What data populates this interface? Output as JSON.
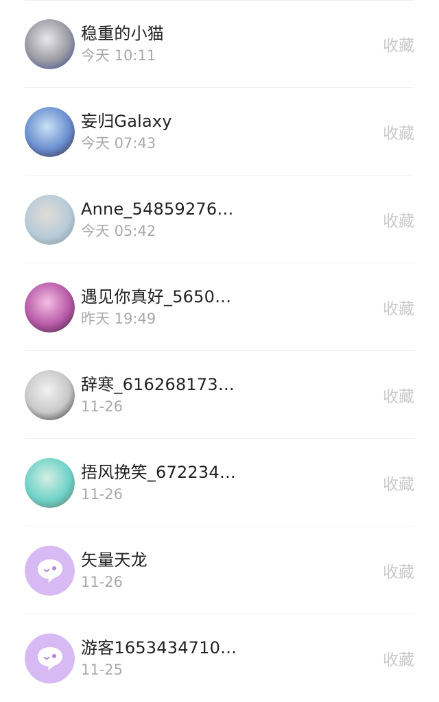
{
  "contacts": [
    {
      "name": "稳重的小猫",
      "time": "今天 10:11",
      "action": "收藏",
      "avatar_type": "photo",
      "avatar_colors": [
        "#e9e7ea",
        "#9a9aa3",
        "#2c3c8c"
      ]
    },
    {
      "name": "妄归Galaxy",
      "time": "今天 07:43",
      "action": "收藏",
      "avatar_type": "photo",
      "avatar_colors": [
        "#c9e1f4",
        "#6b8fd0",
        "#2a1a2a"
      ]
    },
    {
      "name": "Anne_54859276…",
      "time": "今天 05:42",
      "action": "收藏",
      "avatar_type": "photo",
      "avatar_colors": [
        "#e2ddd6",
        "#b7cbd8",
        "#7b8d96"
      ]
    },
    {
      "name": "遇见你真好_5650…",
      "time": "昨天 19:49",
      "action": "收藏",
      "avatar_type": "photo",
      "avatar_colors": [
        "#f4bfe3",
        "#b85aa7",
        "#2b1a2e"
      ]
    },
    {
      "name": "辞寒_616268173…",
      "time": "11-26",
      "action": "收藏",
      "avatar_type": "photo",
      "avatar_colors": [
        "#f2f2f2",
        "#c8c8c8",
        "#1a1a1a"
      ]
    },
    {
      "name": "捂风挽笑_672234…",
      "time": "11-26",
      "action": "收藏",
      "avatar_type": "photo",
      "avatar_colors": [
        "#d7eee4",
        "#6fd3c9",
        "#5c6a57"
      ]
    },
    {
      "name": "矢量天龙",
      "time": "11-26",
      "action": "收藏",
      "avatar_type": "default",
      "avatar_colors": [
        "#d7b9f4",
        "#ffffff",
        "#b285e0"
      ]
    },
    {
      "name": "游客1653434710…",
      "time": "11-25",
      "action": "收藏",
      "avatar_type": "default",
      "avatar_colors": [
        "#d7b9f4",
        "#ffffff",
        "#b285e0"
      ]
    }
  ]
}
